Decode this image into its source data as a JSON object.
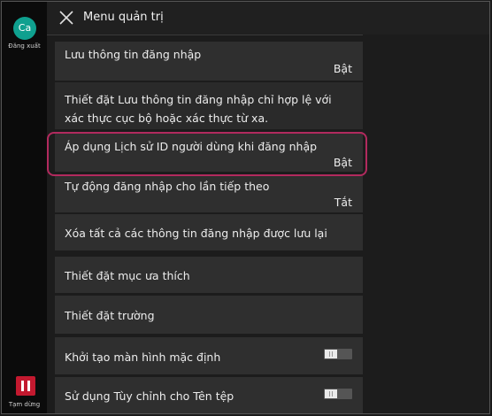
{
  "rail": {
    "avatar_initials": "Ca",
    "logout_label": "Đăng xuất",
    "pause_label": "Tạm dừng",
    "pause_color": "#c3192f",
    "avatar_color": "#0fa08f"
  },
  "header": {
    "title": "Menu quản trị",
    "close_icon": "close-icon"
  },
  "list": {
    "save_login_info": {
      "label": "Lưu thông tin đăng nhập",
      "value": "Bật"
    },
    "note": "Thiết đặt Lưu thông tin đăng nhập chỉ hợp lệ với xác thực cục bộ hoặc xác thực từ xa.",
    "apply_user_id_history": {
      "label": "Áp dụng Lịch sử ID người dùng khi đăng nhập",
      "value": "Bật"
    },
    "auto_login_next": {
      "label": "Tự động đăng nhập cho lần tiếp theo",
      "value": "Tắt"
    },
    "clear_saved_login": {
      "label": "Xóa tất cả các thông tin đăng nhập được lưu lại"
    },
    "favorites_settings": {
      "label": "Thiết đặt mục ưa thích"
    },
    "field_settings": {
      "label": "Thiết đặt trường"
    },
    "init_default_screen": {
      "label": "Khởi tạo màn hình mặc định"
    },
    "custom_file_name": {
      "label": "Sử dụng Tùy chỉnh cho Tên tệp"
    }
  },
  "highlight_color": "#b22a5e"
}
